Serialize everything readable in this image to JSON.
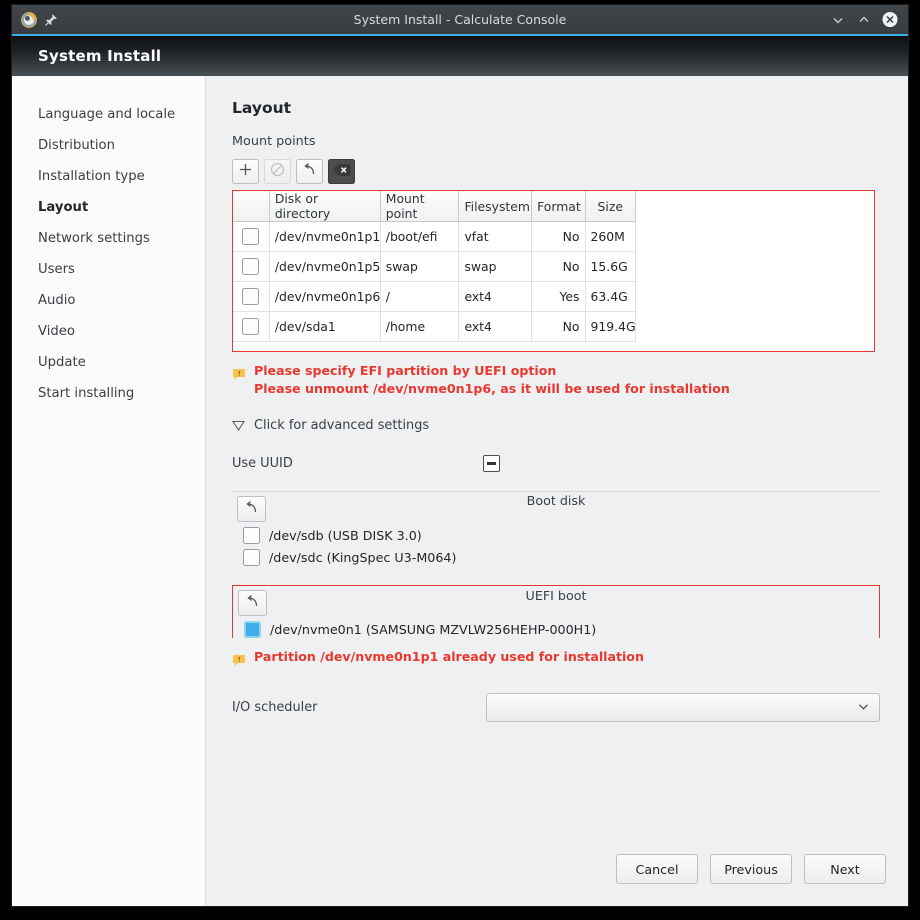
{
  "window": {
    "title": "System Install - Calculate Console",
    "app_icon": "calculate-logo-icon",
    "pin_icon": "pin-icon",
    "minimize_icon": "chevron-down-icon",
    "maximize_icon": "chevron-up-icon",
    "close_icon": "close-icon"
  },
  "header": {
    "title": "System Install"
  },
  "sidebar": {
    "items": [
      {
        "label": "Language and locale",
        "active": false
      },
      {
        "label": "Distribution",
        "active": false
      },
      {
        "label": "Installation type",
        "active": false
      },
      {
        "label": "Layout",
        "active": true
      },
      {
        "label": "Network settings",
        "active": false
      },
      {
        "label": "Users",
        "active": false
      },
      {
        "label": "Audio",
        "active": false
      },
      {
        "label": "Video",
        "active": false
      },
      {
        "label": "Update",
        "active": false
      },
      {
        "label": "Start installing",
        "active": false
      }
    ]
  },
  "main": {
    "page_title": "Layout",
    "mount_points_label": "Mount points",
    "toolbar": [
      {
        "name": "add-mount-point-button",
        "icon": "plus-icon",
        "disabled": false
      },
      {
        "name": "remove-mount-point-button",
        "icon": "forbidden-icon",
        "disabled": true
      },
      {
        "name": "undo-button",
        "icon": "undo-icon",
        "disabled": false
      },
      {
        "name": "clear-all-button",
        "icon": "backspace-icon",
        "disabled": false
      }
    ],
    "table": {
      "columns": [
        "",
        "Disk or directory",
        "Mount point",
        "Filesystem",
        "Format",
        "Size"
      ],
      "rows": [
        {
          "checked": false,
          "disk": "/dev/nvme0n1p1",
          "mount": "/boot/efi",
          "fs": "vfat",
          "format": "No",
          "size": "260M"
        },
        {
          "checked": false,
          "disk": "/dev/nvme0n1p5",
          "mount": "swap",
          "fs": "swap",
          "format": "No",
          "size": "15.6G"
        },
        {
          "checked": false,
          "disk": "/dev/nvme0n1p6",
          "mount": "/",
          "fs": "ext4",
          "format": "Yes",
          "size": "63.4G"
        },
        {
          "checked": false,
          "disk": "/dev/sda1",
          "mount": "/home",
          "fs": "ext4",
          "format": "No",
          "size": "919.4G"
        }
      ]
    },
    "messages": [
      "Please specify EFI partition by UEFI option",
      "Please unmount /dev/nvme0n1p6, as it will be used for installation"
    ],
    "advanced_toggle": {
      "label": "Click for advanced settings",
      "icon": "triangle-down-icon"
    },
    "use_uuid": {
      "label": "Use UUID",
      "state": "indeterminate"
    },
    "boot_disk": {
      "title": "Boot disk",
      "reset_icon": "undo-icon",
      "items": [
        {
          "label": "/dev/sdb (USB DISK 3.0)",
          "checked": false
        },
        {
          "label": "/dev/sdc (KingSpec U3-M064)",
          "checked": false
        }
      ]
    },
    "uefi_boot": {
      "title": "UEFI boot",
      "reset_icon": "undo-icon",
      "items": [
        {
          "label": "/dev/nvme0n1 (SAMSUNG MZVLW256HEHP-000H1)",
          "checked": true
        }
      ],
      "message": "Partition /dev/nvme0n1p1 already used for installation"
    },
    "io_scheduler": {
      "label": "I/O scheduler",
      "value": "",
      "arrow_icon": "chevron-down-icon"
    }
  },
  "footer": {
    "cancel": "Cancel",
    "previous": "Previous",
    "next": "Next"
  },
  "colors": {
    "accent_blue": "#3daee9",
    "error_red": "#e8382f",
    "warn_yellow": "#f8c44f",
    "window_bg": "#eff0f1"
  }
}
